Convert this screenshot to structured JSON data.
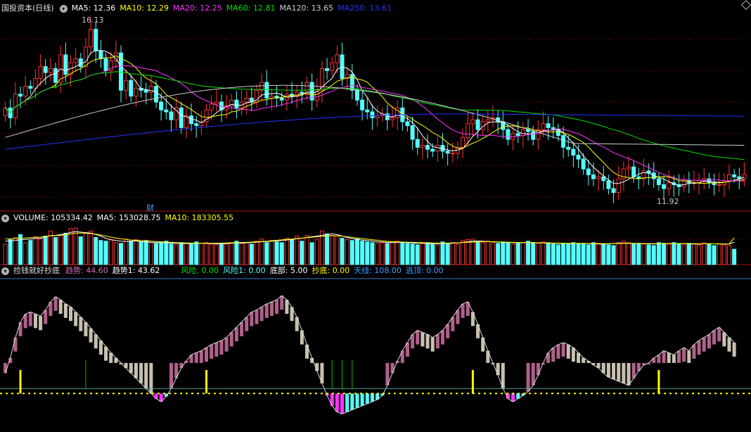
{
  "colors": {
    "up": "#ff3333",
    "down": "#54ffff",
    "grid": "#7a0000",
    "sep": "#b01010",
    "ma5": "#ffffff",
    "ma10": "#ffff00",
    "ma20": "#ff33ff",
    "ma60": "#00e000",
    "ma120": "#cccccc",
    "ma250": "#2233ff",
    "trend_up": "#b0608a",
    "trend_down": "#c8c0b0",
    "risk": "#ff33ff",
    "bottom": "#54ffff",
    "signal": "#ffff00"
  },
  "price_panel": {
    "title": "国投资本(日线)",
    "legend": [
      {
        "label": "MA5: 12.36",
        "color": "#ffffff"
      },
      {
        "label": "MA10: 12.29",
        "color": "#ffff00"
      },
      {
        "label": "MA20: 12.25",
        "color": "#ff33ff"
      },
      {
        "label": "MA60: 12.81",
        "color": "#00e000"
      },
      {
        "label": "MA120: 13.65",
        "color": "#cccccc"
      },
      {
        "label": "MA250: 13.61",
        "color": "#2233ff"
      }
    ],
    "high_label": "16.13",
    "low_label": "11.92",
    "marker": "财"
  },
  "volume_panel": {
    "legend": [
      {
        "label": "VOLUME: 105334.42",
        "color": "#ffffff"
      },
      {
        "label": "MA5: 153028.75",
        "color": "#ffffff"
      },
      {
        "label": "MA10: 183305.55",
        "color": "#ffff00"
      }
    ]
  },
  "indicator_panel": {
    "title": "捡钱就好抄底",
    "legend": [
      {
        "label": "趋势: 44.60",
        "color": "#d070b0"
      },
      {
        "label": "趋势1: 43.62",
        "color": "#ffffff"
      },
      {
        "label": "风险: 0.00",
        "color": "#00e000"
      },
      {
        "label": "风险1: 0.00",
        "color": "#54ffff"
      },
      {
        "label": "底部: 5.00",
        "color": "#ffffff"
      },
      {
        "label": "抄底: 0.00",
        "color": "#ffff00"
      },
      {
        "label": "天线: 108.00",
        "color": "#3aa0ff"
      },
      {
        "label": "逃顶: 0.00",
        "color": "#3aa0ff"
      }
    ]
  },
  "chart_data": [
    {
      "type": "candlestick",
      "title": "国投资本(日线)",
      "ylim": [
        11.5,
        16.4
      ],
      "close": [
        14.05,
        13.8,
        14.4,
        14.35,
        14.6,
        14.55,
        14.8,
        15.1,
        14.95,
        15.05,
        14.7,
        15.4,
        14.9,
        15.2,
        15.3,
        15.1,
        15.6,
        16.05,
        15.5,
        15.3,
        15.0,
        15.25,
        15.45,
        14.5,
        14.75,
        14.35,
        14.55,
        14.5,
        14.45,
        14.6,
        14.2,
        14.0,
        13.95,
        13.75,
        14.05,
        13.55,
        13.85,
        13.65,
        13.6,
        13.7,
        14.0,
        14.15,
        14.2,
        14.0,
        14.1,
        14.25,
        14.05,
        14.2,
        14.3,
        14.2,
        14.5,
        14.7,
        14.3,
        14.35,
        14.3,
        14.25,
        14.4,
        14.35,
        14.45,
        14.4,
        14.7,
        14.25,
        14.5,
        15.05,
        15.0,
        15.2,
        15.4,
        14.8,
        14.9,
        14.5,
        14.25,
        14.0,
        13.95,
        13.8,
        13.85,
        13.9,
        13.75,
        13.8,
        14.05,
        13.7,
        13.6,
        13.25,
        13.05,
        13.1,
        13.0,
        12.95,
        13.1,
        12.95,
        12.9,
        12.9,
        13.05,
        13.3,
        13.65,
        13.75,
        13.5,
        13.7,
        13.75,
        13.8,
        13.7,
        13.5,
        13.25,
        13.4,
        13.35,
        13.5,
        13.45,
        13.25,
        13.5,
        13.65,
        13.55,
        13.5,
        13.35,
        13.05,
        13.0,
        12.85,
        12.75,
        12.5,
        12.35,
        12.25,
        12.3,
        12.2,
        12.0,
        11.9,
        12.25,
        12.5,
        12.55,
        12.3,
        12.25,
        12.45,
        12.4,
        12.25,
        12.1,
        12.0,
        12.15,
        12.1,
        12.05,
        12.2,
        12.15,
        12.15,
        12.2,
        12.25,
        12.15,
        12.1,
        12.1,
        12.2,
        12.35,
        12.3,
        12.25,
        12.36
      ],
      "x_span": 150
    },
    {
      "type": "bar",
      "title": "VOLUME",
      "values": [
        140,
        170,
        185,
        205,
        150,
        165,
        190,
        175,
        195,
        230,
        185,
        200,
        215,
        245,
        250,
        190,
        220,
        230,
        185,
        165,
        160,
        170,
        150,
        145,
        175,
        160,
        170,
        155,
        165,
        150,
        145,
        150,
        160,
        140,
        135,
        150,
        145,
        140,
        155,
        145,
        150,
        140,
        135,
        145,
        140,
        150,
        160,
        145,
        150,
        140,
        160,
        175,
        150,
        165,
        155,
        150,
        180,
        170,
        195,
        160,
        200,
        150,
        175,
        230,
        210,
        200,
        195,
        180,
        170,
        165,
        175,
        160,
        155,
        150,
        145,
        150,
        145,
        155,
        160,
        150,
        145,
        140,
        135,
        145,
        150,
        140,
        135,
        155,
        145,
        150,
        140,
        165,
        170,
        175,
        155,
        150,
        160,
        150,
        145,
        155,
        150,
        140,
        145,
        150,
        160,
        150,
        145,
        155,
        150,
        140,
        135,
        145,
        140,
        150,
        145,
        140,
        135,
        150,
        145,
        140,
        135,
        130,
        150,
        160,
        150,
        140,
        145,
        140,
        135,
        130,
        150,
        145,
        140,
        150,
        140,
        135,
        145,
        140,
        135,
        150,
        140,
        130,
        140,
        135,
        130,
        105
      ],
      "ma5": [
        160,
        162,
        165,
        170,
        172,
        175,
        178,
        180,
        190,
        198,
        200,
        205,
        210,
        220,
        225,
        222,
        218,
        215,
        205,
        195,
        180,
        170,
        165,
        160,
        158,
        160,
        162,
        158,
        155,
        152,
        150,
        150,
        148,
        147,
        146,
        145,
        144,
        145,
        146,
        145,
        144,
        143,
        142,
        143,
        144,
        146,
        148,
        147,
        149,
        151,
        153,
        156,
        158,
        160,
        162,
        164,
        168,
        172,
        176,
        180,
        186,
        190,
        195,
        200,
        205,
        210,
        205,
        195,
        185,
        178,
        172,
        168,
        164,
        160,
        156,
        154,
        152,
        150,
        151,
        152,
        150,
        148,
        146,
        145,
        145,
        144,
        143,
        144,
        145,
        146,
        148,
        152,
        156,
        160,
        161,
        160,
        158,
        156,
        154,
        152,
        151,
        150,
        149,
        150,
        151,
        150,
        149,
        148,
        147,
        146,
        145,
        144,
        143,
        144,
        145,
        144,
        143,
        142,
        141,
        140,
        142,
        144,
        146,
        147,
        146,
        145,
        144,
        143,
        142,
        141,
        142,
        143,
        144,
        145,
        144,
        143,
        142,
        141,
        140,
        142,
        143,
        142,
        141,
        140,
        140,
        153
      ],
      "ma10": [
        175,
        176,
        178,
        180,
        182,
        184,
        186,
        188,
        192,
        196,
        198,
        200,
        204,
        210,
        214,
        216,
        214,
        212,
        208,
        202,
        195,
        188,
        182,
        176,
        172,
        168,
        166,
        164,
        162,
        160,
        158,
        156,
        154,
        152,
        150,
        149,
        148,
        147,
        147,
        146,
        146,
        146,
        146,
        147,
        148,
        149,
        150,
        151,
        152,
        154,
        156,
        158,
        160,
        163,
        166,
        169,
        172,
        175,
        178,
        181,
        184,
        187,
        190,
        193,
        196,
        198,
        197,
        194,
        190,
        186,
        182,
        178,
        174,
        170,
        166,
        162,
        159,
        157,
        155,
        154,
        153,
        152,
        151,
        150,
        149,
        148,
        147,
        147,
        147,
        148,
        149,
        150,
        152,
        154,
        156,
        157,
        157,
        156,
        155,
        154,
        153,
        152,
        151,
        150,
        150,
        150,
        149,
        148,
        148,
        147,
        147,
        146,
        145,
        145,
        145,
        145,
        144,
        144,
        143,
        143,
        143,
        143,
        144,
        145,
        145,
        145,
        145,
        144,
        144,
        143,
        143,
        143,
        143,
        144,
        144,
        144,
        143,
        143,
        142,
        142,
        142,
        142,
        142,
        141,
        141,
        183
      ]
    },
    {
      "type": "bar",
      "title": "捡钱就好抄底",
      "trend": [
        20,
        35,
        55,
        70,
        78,
        80,
        78,
        76,
        82,
        90,
        95,
        92,
        88,
        85,
        80,
        75,
        70,
        64,
        58,
        52,
        46,
        40,
        35,
        30,
        25,
        20,
        15,
        10,
        5,
        0,
        -5,
        -8,
        -3,
        5,
        15,
        25,
        32,
        38,
        40,
        42,
        45,
        48,
        50,
        52,
        55,
        60,
        65,
        70,
        75,
        80,
        82,
        85,
        88,
        90,
        92,
        96,
        92,
        85,
        75,
        62,
        48,
        35,
        22,
        10,
        -2,
        -12,
        -18,
        -20,
        -18,
        -16,
        -14,
        -12,
        -10,
        -8,
        -6,
        -2,
        8,
        20,
        32,
        42,
        50,
        58,
        62,
        60,
        58,
        55,
        58,
        62,
        68,
        75,
        82,
        88,
        90,
        80,
        68,
        55,
        42,
        30,
        18,
        5,
        -5,
        -8,
        -5,
        -2,
        2,
        8,
        18,
        30,
        40,
        45,
        48,
        50,
        48,
        45,
        40,
        35,
        32,
        28,
        25,
        20,
        16,
        14,
        12,
        10,
        8,
        15,
        22,
        28,
        30,
        35,
        38,
        42,
        40,
        38,
        42,
        45,
        42,
        48,
        52,
        55,
        58,
        62,
        65,
        60,
        55,
        50
      ],
      "signal_bars": [
        3,
        40,
        93,
        130,
        154
      ],
      "ylim": [
        -35,
        110
      ]
    }
  ]
}
